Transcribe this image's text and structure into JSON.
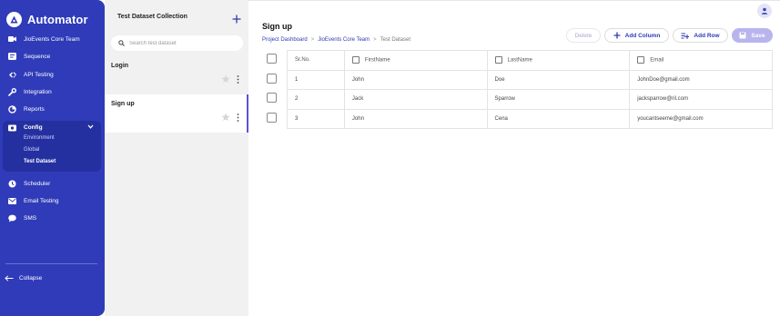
{
  "app": {
    "name": "Automator"
  },
  "sidebar": {
    "items": [
      {
        "label": "JioEvents Core Team",
        "icon": "video-icon"
      },
      {
        "label": "Sequence",
        "icon": "sequence-icon"
      },
      {
        "label": "API Testing",
        "icon": "api-icon"
      },
      {
        "label": "Integration",
        "icon": "wrench-icon"
      },
      {
        "label": "Reports",
        "icon": "reports-icon"
      }
    ],
    "config": {
      "label": "Config",
      "sub_items": [
        "Environment",
        "Global",
        "Test Dataset"
      ],
      "active_sub": "Test Dataset"
    },
    "items_after": [
      {
        "label": "Scheduler",
        "icon": "clock-icon"
      },
      {
        "label": "Email Testing",
        "icon": "mail-icon"
      },
      {
        "label": "SMS",
        "icon": "chat-icon"
      }
    ],
    "collapse_label": "Collapse"
  },
  "collection": {
    "title": "Test Dataset Collection",
    "search_placeholder": "Search test dataset",
    "datasets": [
      {
        "name": "Login",
        "active": false
      },
      {
        "name": "Sign up",
        "active": true
      }
    ]
  },
  "main": {
    "title": "Sign up",
    "breadcrumb": [
      "Project Dashboard",
      "JioEvents Core Team",
      "Test Dataset"
    ],
    "buttons": {
      "delete": "Delete",
      "add_column": "Add Column",
      "add_row": "Add Row",
      "save": "Save"
    },
    "table": {
      "columns": [
        "Sr.No.",
        "FirstName",
        "LastName",
        "Email"
      ],
      "rows": [
        [
          "1",
          "John",
          "Doe",
          "JohnDoe@gmail.com"
        ],
        [
          "2",
          "Jack",
          "Sparrow",
          "jacksparrow@ril.com"
        ],
        [
          "3",
          "John",
          "Cena",
          "youcantseeme@gmail.com"
        ]
      ]
    }
  },
  "colors": {
    "sidebar": "#2f3bb8",
    "accent": "#2e3ab5",
    "save_button": "#b7b4ee"
  }
}
